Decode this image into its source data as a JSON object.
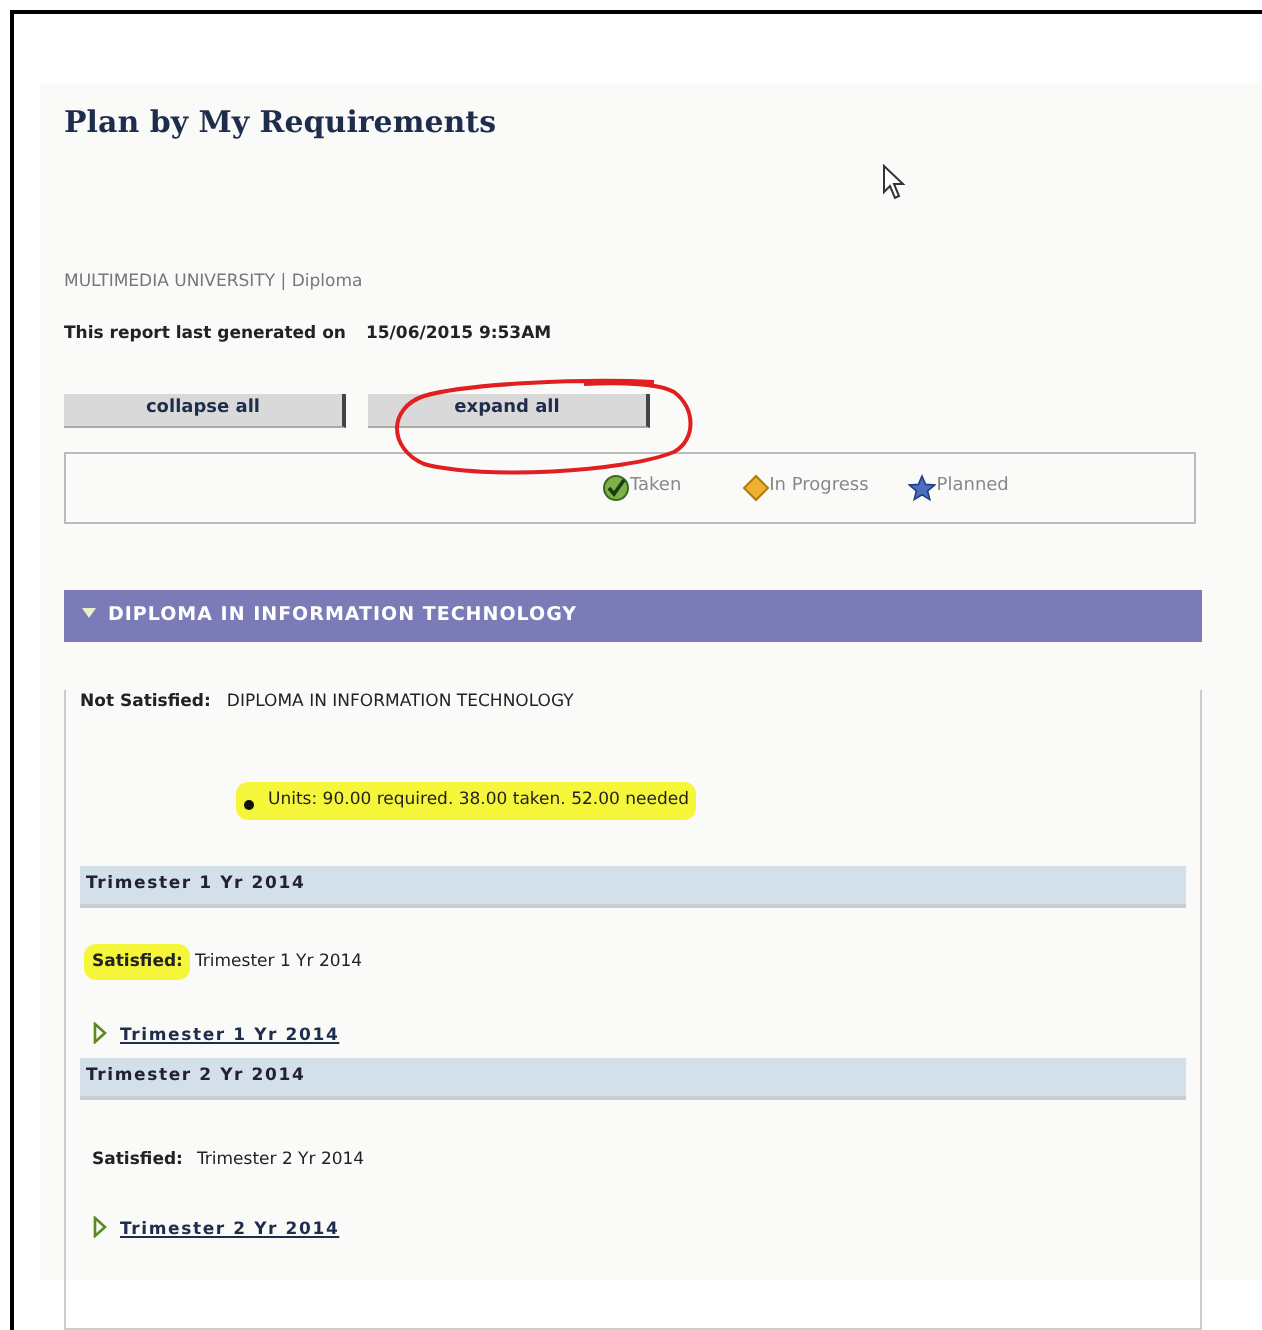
{
  "title": "Plan by My Requirements",
  "institution": "MULTIMEDIA UNIVERSITY | Diploma",
  "report_label": "This report last generated on",
  "report_date": "15/06/2015 9:53AM",
  "buttons": [
    {
      "label": "collapse all",
      "circled": false
    },
    {
      "label": "expand all",
      "circled": true
    }
  ],
  "legend": [
    {
      "kind": "taken",
      "label": "Taken"
    },
    {
      "kind": "in_progress",
      "label": "In Progress"
    },
    {
      "kind": "planned",
      "label": "Planned"
    }
  ],
  "requirement": {
    "title": "DIPLOMA IN INFORMATION TECHNOLOGY",
    "expanded": true,
    "status_label": "Not Satisfied:",
    "status_text": "DIPLOMA IN INFORMATION TECHNOLOGY",
    "units": {
      "text": "Units: 90.00 required. 38.00 taken. 52.00 needed",
      "highlighted": true
    },
    "terms": [
      {
        "header": "Trimester 1 Yr 2014",
        "status_label": "Satisfied:",
        "label_highlighted": true,
        "status_text": "Trimester 1 Yr 2014",
        "link": "Trimester 1 Yr 2014",
        "expanded": false
      },
      {
        "header": "Trimester 2 Yr 2014",
        "status_label": "Satisfied:",
        "label_highlighted": false,
        "status_text": "Trimester 2 Yr 2014",
        "link": "Trimester 2 Yr 2014",
        "expanded": false
      }
    ]
  }
}
